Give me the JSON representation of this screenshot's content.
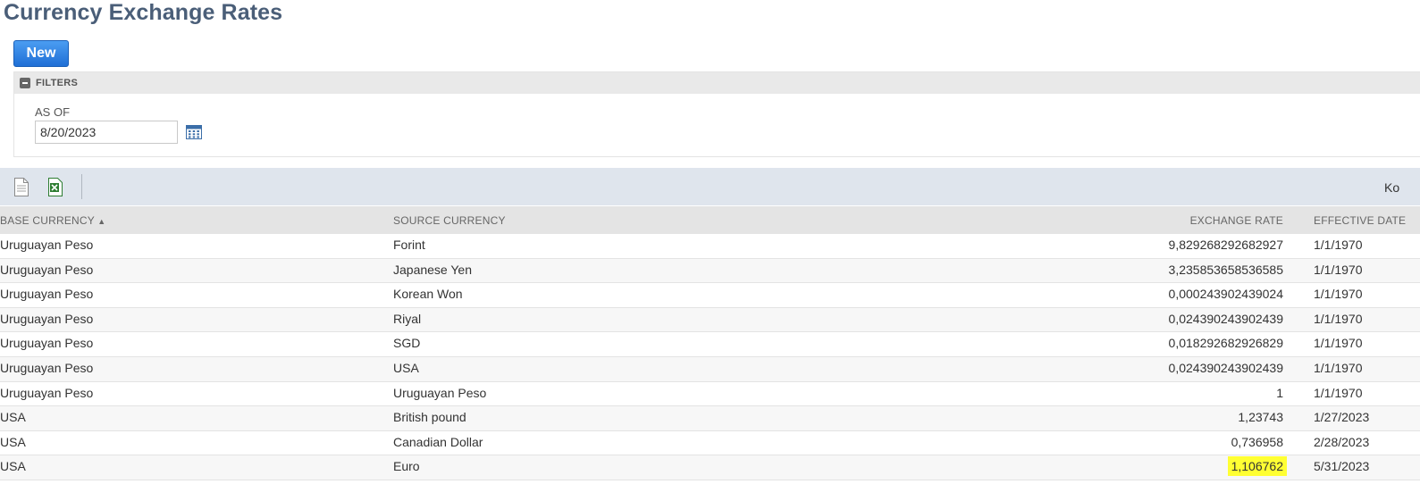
{
  "page": {
    "title": "Currency Exchange Rates"
  },
  "actions": {
    "new_label": "New"
  },
  "filters": {
    "header_label": "FILTERS",
    "as_of_label": "AS OF",
    "as_of_value": "8/20/2023"
  },
  "toolbar": {
    "right_text": "Ko"
  },
  "table": {
    "headers": {
      "base": "BASE CURRENCY",
      "sort_indicator": "▲",
      "source": "SOURCE CURRENCY",
      "rate": "EXCHANGE RATE",
      "date": "EFFECTIVE DATE"
    },
    "rows": [
      {
        "base": "Uruguayan Peso",
        "source": "Forint",
        "rate": "9,829268292682927",
        "date": "1/1/1970"
      },
      {
        "base": "Uruguayan Peso",
        "source": "Japanese Yen",
        "rate": "3,235853658536585",
        "date": "1/1/1970"
      },
      {
        "base": "Uruguayan Peso",
        "source": "Korean Won",
        "rate": "0,000243902439024",
        "date": "1/1/1970"
      },
      {
        "base": "Uruguayan Peso",
        "source": "Riyal",
        "rate": "0,024390243902439",
        "date": "1/1/1970"
      },
      {
        "base": "Uruguayan Peso",
        "source": "SGD",
        "rate": "0,018292682926829",
        "date": "1/1/1970"
      },
      {
        "base": "Uruguayan Peso",
        "source": "USA",
        "rate": "0,024390243902439",
        "date": "1/1/1970"
      },
      {
        "base": "Uruguayan Peso",
        "source": "Uruguayan Peso",
        "rate": "1",
        "date": "1/1/1970"
      },
      {
        "base": "USA",
        "source": "British pound",
        "rate": "1,23743",
        "date": "1/27/2023"
      },
      {
        "base": "USA",
        "source": "Canadian Dollar",
        "rate": "0,736958",
        "date": "2/28/2023"
      },
      {
        "base": "USA",
        "source": "Euro",
        "rate": "1,106762",
        "date": "5/31/2023",
        "highlighted": true
      }
    ]
  },
  "colors": {
    "title": "#4a5e78",
    "primary_button": "#2a7de1",
    "highlight": "#ffff33",
    "toolbar_bg": "#dfe5ed"
  },
  "icons": {
    "calendar": "calendar-icon",
    "export_csv": "document-icon",
    "export_excel": "excel-icon",
    "collapse": "minus-square-icon"
  }
}
